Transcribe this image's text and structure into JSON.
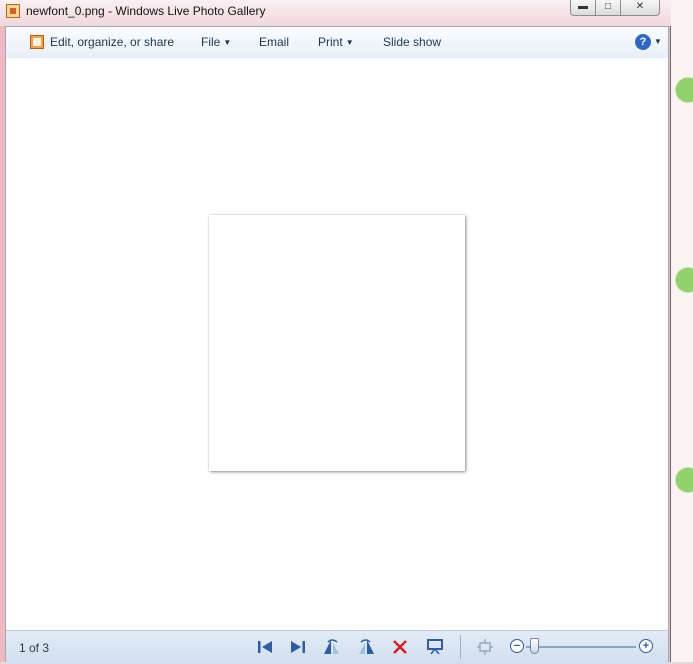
{
  "window": {
    "title": "newfont_0.png - Windows Live Photo Gallery",
    "minimize_icon": "minimize-icon",
    "maximize_icon": "maximize-icon",
    "close_icon": "close-icon"
  },
  "toolbar": {
    "edit_label": "Edit, organize, or share",
    "file_label": "File",
    "email_label": "Email",
    "print_label": "Print",
    "slideshow_label": "Slide show",
    "help_icon": "help-icon"
  },
  "statusbar": {
    "counter": "1 of 3"
  },
  "colors": {
    "toolbar_text": "#1e3650",
    "accent": "#2b5ea8",
    "delete_red": "#d42020"
  }
}
